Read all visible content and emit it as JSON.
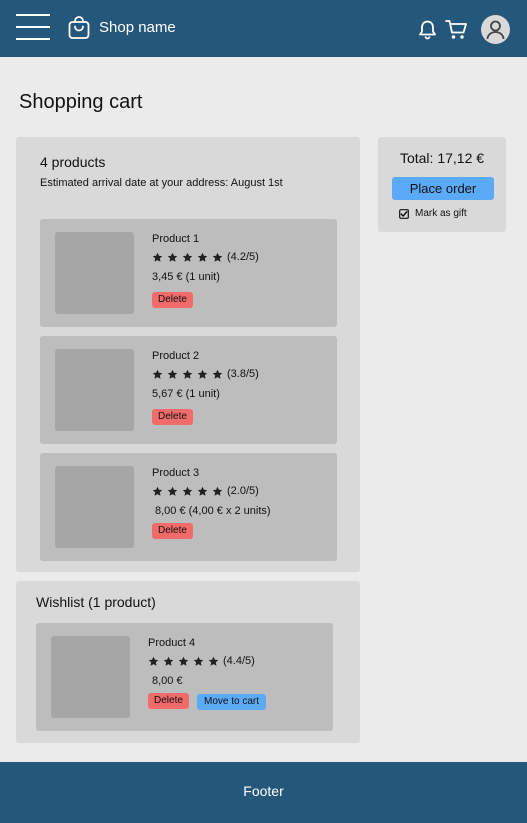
{
  "header": {
    "shop_name": "Shop name",
    "icons": [
      "menu-icon",
      "shopping-bag-icon",
      "bell-icon",
      "cart-icon",
      "user-avatar-icon"
    ],
    "color": "#25577a"
  },
  "page_title": "Shopping cart",
  "cart": {
    "count_label": "4 products",
    "arrival": "Estimated arrival date at your address: August 1st",
    "products": [
      {
        "name": "Product 1",
        "rating": 4.2,
        "rating_label": "(4.2/5)",
        "price": "3,45 € (1 unit)",
        "delete_label": "Delete"
      },
      {
        "name": "Product 2",
        "rating": 3.8,
        "rating_label": "(3.8/5)",
        "price": "5,67 € (1 unit)",
        "delete_label": "Delete"
      },
      {
        "name": "Product 3",
        "rating": 2.0,
        "rating_label": "(2.0/5)",
        "price": "8,00 € (4,00 € x 2 units)",
        "delete_label": "Delete"
      }
    ]
  },
  "wishlist": {
    "title": "Wishlist (1 product)",
    "items": [
      {
        "name": "Product 4",
        "rating": 4.4,
        "rating_label": "(4.4/5)",
        "price": "8,00 €",
        "delete_label": "Delete",
        "move_label": "Move to cart"
      }
    ]
  },
  "summary": {
    "total": "Total: 17,12 €",
    "order_label": "Place order",
    "gift_label": "Mark as gift",
    "gift_checked": true
  },
  "footer": {
    "text": "Footer"
  },
  "colors": {
    "accent": "#5aaaf7",
    "danger": "#f16b6b",
    "brand": "#25577a"
  }
}
